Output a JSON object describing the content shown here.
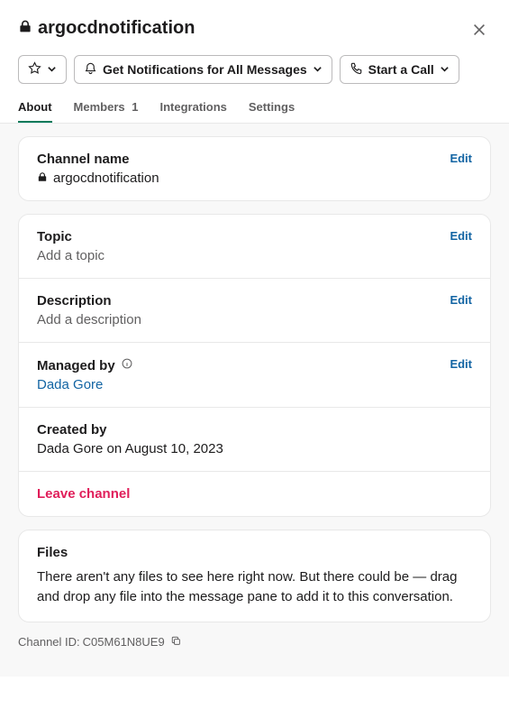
{
  "header": {
    "title": "argocdnotification"
  },
  "actions": {
    "notifications": "Get Notifications for All Messages",
    "call": "Start a Call"
  },
  "tabs": {
    "about": "About",
    "members_label": "Members",
    "members_count": "1",
    "integrations": "Integrations",
    "settings": "Settings"
  },
  "channel_name": {
    "label": "Channel name",
    "value": "argocdnotification",
    "edit": "Edit"
  },
  "topic": {
    "label": "Topic",
    "placeholder": "Add a topic",
    "edit": "Edit"
  },
  "description": {
    "label": "Description",
    "placeholder": "Add a description",
    "edit": "Edit"
  },
  "managed_by": {
    "label": "Managed by",
    "value": "Dada Gore",
    "edit": "Edit"
  },
  "created_by": {
    "label": "Created by",
    "value": "Dada Gore on August 10, 2023"
  },
  "leave": "Leave channel",
  "files": {
    "label": "Files",
    "text": "There aren't any files to see here right now. But there could be — drag and drop any file into the message pane to add it to this conversation."
  },
  "channel_id": {
    "prefix": "Channel ID: ",
    "value": "C05M61N8UE9"
  }
}
